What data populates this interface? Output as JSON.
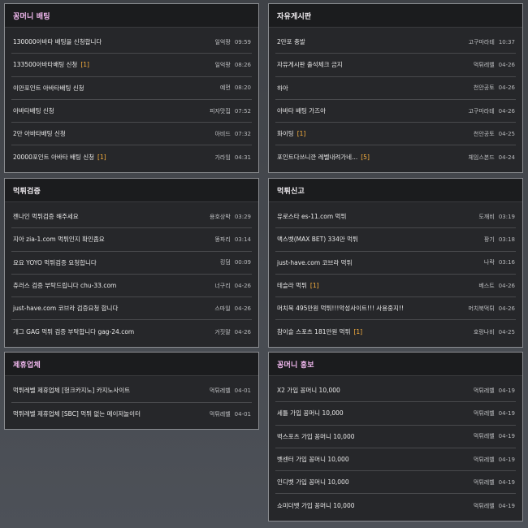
{
  "panels": [
    {
      "id": "coin-betting",
      "title": "꽁머니 배팅",
      "title_accent": true,
      "rows": [
        {
          "title": "130000아바타 배팅을 신청합니다",
          "count": "",
          "author": "일억팡",
          "time": "09:59"
        },
        {
          "title": "133500아바타배팅 신청",
          "count": "[1]",
          "author": "일억팡",
          "time": "08:26"
        },
        {
          "title": "이만포인트 아바타배팅 신청",
          "count": "",
          "author": "예먼",
          "time": "08:20"
        },
        {
          "title": "아바타배팅 신청",
          "count": "",
          "author": "피자맛집",
          "time": "07:52"
        },
        {
          "title": "2만 아바타배팅 신청",
          "count": "",
          "author": "아비드",
          "time": "07:32"
        },
        {
          "title": "20000포인트 아바타 배팅 신청",
          "count": "[1]",
          "author": "가라임",
          "time": "04:31"
        }
      ]
    },
    {
      "id": "free-board",
      "title": "자유게시판",
      "title_accent": false,
      "rows": [
        {
          "title": "2만포 충발",
          "count": "",
          "author": "고구마라테",
          "time": "10:37"
        },
        {
          "title": "자유게시판 출석체크 금지",
          "count": "",
          "author": "먹튀레벨",
          "time": "04-26"
        },
        {
          "title": "하아",
          "count": "",
          "author": "천안공토",
          "time": "04-26"
        },
        {
          "title": "아바타 배팅 가즈아",
          "count": "",
          "author": "고구마라테",
          "time": "04-26"
        },
        {
          "title": "화이팅",
          "count": "[1]",
          "author": "천안공토",
          "time": "04-25"
        },
        {
          "title": "포인트다쓰니깐 레벨내려가네...",
          "count": "[5]",
          "author": "체임스본드",
          "time": "04-24"
        }
      ]
    },
    {
      "id": "verification",
      "title": "먹튀검증",
      "title_accent": false,
      "rows": [
        {
          "title": "젠나인 먹튀검증 해주세요",
          "count": "",
          "author": "용호상박",
          "time": "03:29"
        },
        {
          "title": "지아 zia-1.com 먹튀인지 확인좀요",
          "count": "",
          "author": "똥파리",
          "time": "03:14"
        },
        {
          "title": "요요 YOYO 먹튀검증 요청합니다",
          "count": "",
          "author": "킹덤",
          "time": "00:09"
        },
        {
          "title": "츄러스 검증 부탁드립니다 chu-33.com",
          "count": "",
          "author": "너구리",
          "time": "04-26"
        },
        {
          "title": "just-have.com 코브라 검증요청 합니다",
          "count": "",
          "author": "스마일",
          "time": "04-26"
        },
        {
          "title": "개그 GAG 먹튀 검증 부탁합니다 gag-24.com",
          "count": "",
          "author": "거짓말",
          "time": "04-26"
        }
      ]
    },
    {
      "id": "scam-report",
      "title": "먹튀신고",
      "title_accent": false,
      "rows": [
        {
          "title": "유로스타 es-11.com 먹튀",
          "count": "",
          "author": "도깨비",
          "time": "03:19"
        },
        {
          "title": "맥스벳(MAX BET) 334만 먹튀",
          "count": "",
          "author": "팡기",
          "time": "03:18"
        },
        {
          "title": "just-have.com 코브라 먹튀",
          "count": "",
          "author": "나락",
          "time": "03:16"
        },
        {
          "title": "테슬라 먹튀",
          "count": "[1]",
          "author": "베스트",
          "time": "04-26"
        },
        {
          "title": "머치북 495만원 먹튀!!!악성사이트!!! 사용중지!!",
          "count": "",
          "author": "머치북먹튀",
          "time": "04-26"
        },
        {
          "title": "참이슬 스포츠 181만원 먹튀",
          "count": "[1]",
          "author": "호랑나비",
          "time": "04-25"
        }
      ]
    },
    {
      "id": "partners",
      "title": "제휴업체",
      "title_accent": true,
      "rows": [
        {
          "title": "먹튀레벨 제휴업체 [헝크카지노] 카지노사이트",
          "count": "",
          "author": "먹튀레벨",
          "time": "04-01"
        },
        {
          "title": "먹튀레벨 제휴업체 [SBC] 먹튀 없는 메이저놀이터",
          "count": "",
          "author": "먹튀레벨",
          "time": "04-01"
        }
      ]
    },
    {
      "id": "coin-promo",
      "title": "꽁머니 홍보",
      "title_accent": true,
      "rows": [
        {
          "title": "X2 가입 꽁머니 10,000",
          "count": "",
          "author": "먹튀레벨",
          "time": "04-19"
        },
        {
          "title": "세틀 가입 꽁머니 10,000",
          "count": "",
          "author": "먹튀레벨",
          "time": "04-19"
        },
        {
          "title": "벅스포츠 가입 꽁머니 10,000",
          "count": "",
          "author": "먹튀레벨",
          "time": "04-19"
        },
        {
          "title": "벳센터 가입 꽁머니 10,000",
          "count": "",
          "author": "먹튀레벨",
          "time": "04-19"
        },
        {
          "title": "인디벳 가입 꽁머니 10,000",
          "count": "",
          "author": "먹튀레벨",
          "time": "04-19"
        },
        {
          "title": "쇼미더벳 가입 꽁머니 10,000",
          "count": "",
          "author": "먹튀레벨",
          "time": "04-19"
        }
      ]
    }
  ],
  "colors": {
    "page_background": "#45484d",
    "panel_background": "#26272a",
    "panel_header": "#1b1c1e",
    "panel_border": "#8b8d91",
    "accent_title": "#f1b8ef",
    "comment_count": "#ffb43e",
    "row_text": "#e9e9e9"
  }
}
